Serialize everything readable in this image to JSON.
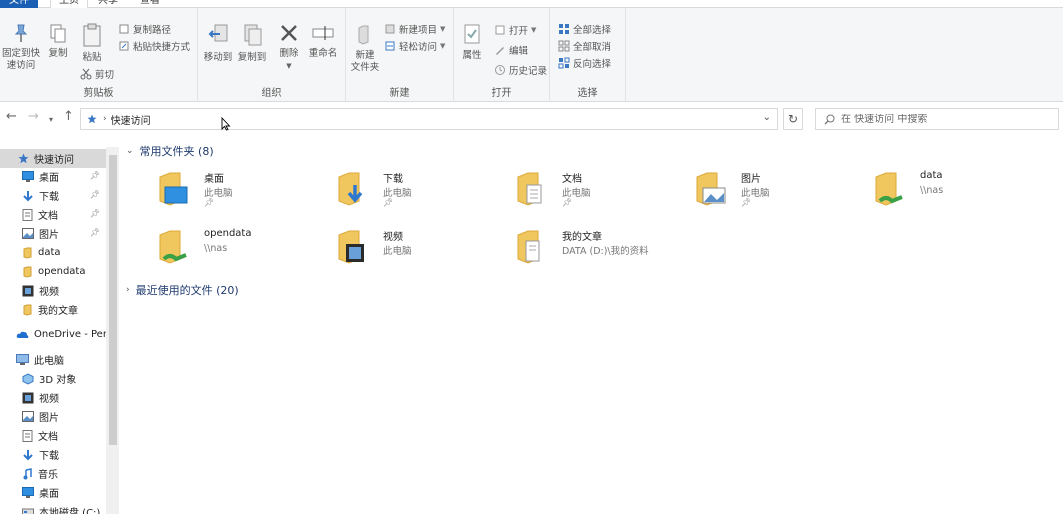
{
  "ribbon_tabs": {
    "file": "文件",
    "home": "主页",
    "share": "共享",
    "view": "查看"
  },
  "ribbon": {
    "clipboard": {
      "label": "剪贴板",
      "pin_quick": "固定到快\n速访问",
      "copy": "复制",
      "paste": "粘贴",
      "copy_path": "复制路径",
      "paste_shortcut": "粘贴快捷方式",
      "cut": "剪切"
    },
    "organize": {
      "label": "组织",
      "move_to": "移动到",
      "copy_to": "复制到",
      "delete": "删除",
      "rename": "重命名"
    },
    "new": {
      "label": "新建",
      "new_folder": "新建\n文件夹",
      "new_item": "新建项目",
      "easy_access": "轻松访问"
    },
    "open": {
      "label": "打开",
      "properties": "属性",
      "open": "打开",
      "edit": "编辑",
      "history": "历史记录"
    },
    "select": {
      "label": "选择",
      "select_all": "全部选择",
      "select_none": "全部取消",
      "invert": "反向选择"
    }
  },
  "address": {
    "crumb": "快速访问",
    "search_placeholder": "在 快速访问 中搜索"
  },
  "nav": {
    "quick_access": "快速访问",
    "items": [
      {
        "label": "桌面",
        "pinned": true
      },
      {
        "label": "下载",
        "pinned": true
      },
      {
        "label": "文档",
        "pinned": true
      },
      {
        "label": "图片",
        "pinned": true
      },
      {
        "label": "data",
        "pinned": false
      },
      {
        "label": "opendata",
        "pinned": false
      },
      {
        "label": "视频",
        "pinned": false
      },
      {
        "label": "我的文章",
        "pinned": false
      }
    ],
    "onedrive": "OneDrive - Perso",
    "this_pc": "此电脑",
    "pc_items": [
      "3D 对象",
      "视频",
      "图片",
      "文档",
      "下载",
      "音乐",
      "桌面",
      "本地磁盘 (C:)"
    ]
  },
  "content": {
    "frequent_header": "常用文件夹 (8)",
    "recent_header": "最近使用的文件 (20)",
    "folders": [
      {
        "name": "桌面",
        "sub": "此电脑",
        "pinned": true
      },
      {
        "name": "下载",
        "sub": "此电脑",
        "pinned": true
      },
      {
        "name": "文档",
        "sub": "此电脑",
        "pinned": true
      },
      {
        "name": "图片",
        "sub": "此电脑",
        "pinned": true
      },
      {
        "name": "data",
        "sub": "\\\\nas",
        "pinned": false
      },
      {
        "name": "opendata",
        "sub": "\\\\nas",
        "pinned": false
      },
      {
        "name": "视频",
        "sub": "此电脑",
        "pinned": false
      },
      {
        "name": "我的文章",
        "sub": "DATA (D:)\\我的资料",
        "pinned": false
      }
    ]
  },
  "colors": {
    "accent": "#1a5fb4",
    "folder_yellow": "#f0c75e",
    "folder_dark": "#dcaa3a",
    "selection": "#d9d9d9",
    "section_text": "#1e3a6e"
  }
}
